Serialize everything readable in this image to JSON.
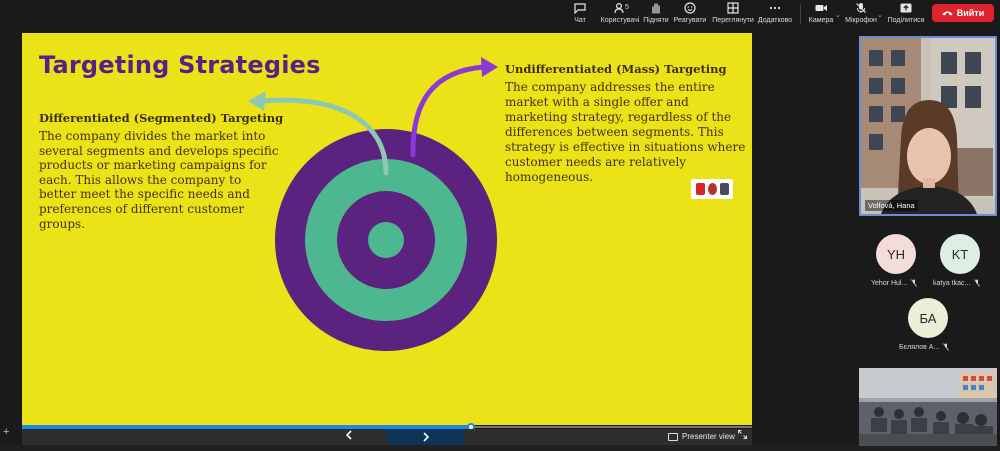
{
  "toolbar": {
    "items": [
      {
        "label": "Чат",
        "icon": "chat-icon"
      },
      {
        "label": "Користувачі",
        "icon": "participants-icon",
        "count": "5"
      },
      {
        "label": "Підняти",
        "icon": "raise-hand-icon"
      },
      {
        "label": "Реагувати",
        "icon": "react-icon"
      },
      {
        "label": "Переглянути",
        "icon": "view-icon"
      },
      {
        "label": "Додатково",
        "icon": "more-icon"
      },
      {
        "label": "Камера",
        "icon": "camera-icon"
      },
      {
        "label": "Мікрофон",
        "icon": "mic-off-icon"
      },
      {
        "label": "Поділитися",
        "icon": "share-icon"
      }
    ],
    "leave_label": "Вийти"
  },
  "slide": {
    "title": "Targeting Strategies",
    "left_heading": "Differentiated (Segmented) Targeting",
    "left_text": "The company divides the market into several segments and develops specific products or marketing campaigns for each. This allows the company to better meet the specific needs and preferences of different customer groups.",
    "right_heading": "Undifferentiated (Mass) Targeting",
    "right_text": "The company addresses the entire market with a single offer and marketing strategy, regardless of the differences between segments. This strategy is effective in situations where customer needs are relatively homogeneous.",
    "colors": {
      "background": "#ece218",
      "purple": "#5b2280",
      "teal": "#4db88f",
      "title": "#5a1f86"
    }
  },
  "presenter_bar": {
    "presenter_view_label": "Presenter view",
    "prev_icon": "chevron-left-icon",
    "next_icon": "chevron-right-icon",
    "progress": 0.61
  },
  "participants": {
    "speaker": {
      "name": "Volfová, Hana"
    },
    "others": [
      {
        "initials": "YH",
        "name": "Yehor Hul...",
        "color": "#f3dcd9"
      },
      {
        "initials": "KT",
        "name": "katya tkac...",
        "color": "#dfeee5"
      },
      {
        "initials": "БА",
        "name": "Бєлялов А...",
        "color": "#ecefd7"
      }
    ]
  }
}
